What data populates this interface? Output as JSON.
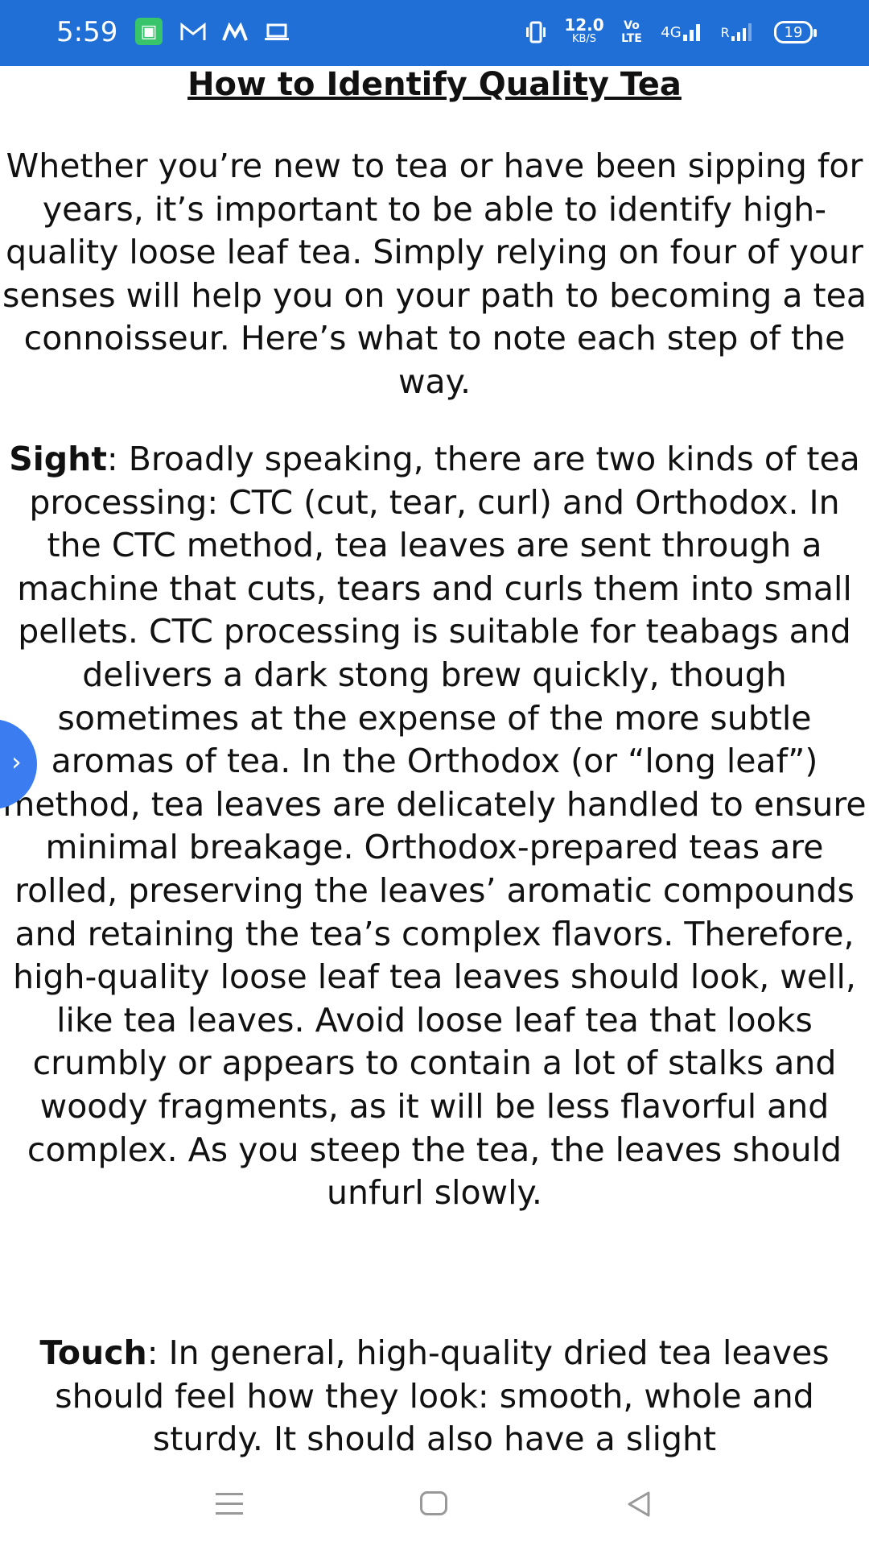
{
  "status_bar": {
    "time": "5:59",
    "icons": [
      "app-icon",
      "gmail-icon",
      "m-app-icon",
      "laptop-icon"
    ],
    "net_speed_value": "12.0",
    "net_speed_unit": "KB/S",
    "volte_top": "Vo",
    "volte_bottom": "LTE",
    "signal1_label": "4G",
    "signal2_label": "R",
    "battery": "19"
  },
  "article": {
    "title": "How to Identify Quality Tea",
    "intro": "Whether you’re new to tea or have been sipping for years, it’s important to be able to identify high-quality loose leaf tea. Simply relying on four of your senses will help you on your path to becoming a tea connoisseur. Here’s what to note each step of the way.",
    "sight_label": "Sight",
    "sight_text": ": Broadly speaking, there are two kinds of tea processing: CTC (cut, tear, curl) and Orthodox. In the CTC method, tea leaves are sent through a machine that cuts, tears and curls them into small pellets. CTC processing is suitable for teabags and delivers a dark stong brew quickly, though sometimes at the expense of the more subtle aromas of tea. In the Orthodox (or “long leaf”) method, tea leaves are delicately handled to ensure minimal breakage. Orthodox-prepared teas are rolled, preserving the leaves’ aromatic compounds and retaining the tea’s complex flavors. Therefore, high-quality loose leaf tea leaves should look, well, like tea leaves. Avoid loose leaf tea that looks crumbly or appears to contain a lot of stalks and woody fragments, as it will be less flavorful and complex. As you steep the tea, the leaves should unfurl slowly.",
    "touch_label": "Touch",
    "touch_text": ": In general, high-quality dried tea leaves should feel how they look: smooth, whole and sturdy. It should also have a slight"
  },
  "floating_button": {
    "icon": "chevron-right-icon",
    "glyph": "›"
  },
  "nav_bar": {
    "icons": [
      "menu-icon",
      "home-icon",
      "back-icon"
    ]
  }
}
